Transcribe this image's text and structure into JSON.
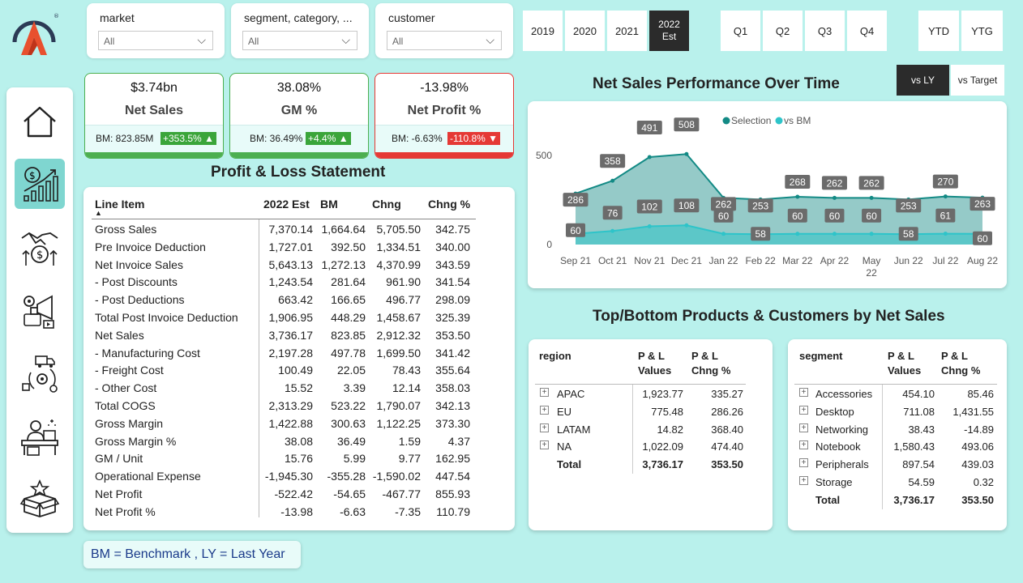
{
  "slicers": [
    {
      "label": "market",
      "value": "All"
    },
    {
      "label": "segment, category, ...",
      "value": "All"
    },
    {
      "label": "customer",
      "value": "All"
    }
  ],
  "years": [
    {
      "label": "2019",
      "selected": false
    },
    {
      "label": "2020",
      "selected": false
    },
    {
      "label": "2021",
      "selected": false
    },
    {
      "label": "2022",
      "sub": "Est",
      "selected": true
    }
  ],
  "quarters": [
    "Q1",
    "Q2",
    "Q3",
    "Q4"
  ],
  "ytd": [
    "YTD",
    "YTG"
  ],
  "compare": [
    {
      "label": "vs LY",
      "selected": true
    },
    {
      "label": "vs Target",
      "selected": false
    }
  ],
  "kpis": [
    {
      "value": "$3.74bn",
      "name": "Net Sales",
      "bm": "BM: 823.85M",
      "chg": "+353.5%",
      "dir": "up",
      "color": "#4caf50"
    },
    {
      "value": "38.08%",
      "name": "GM %",
      "bm": "BM: 36.49%",
      "chg": "+4.4%",
      "dir": "up",
      "color": "#4caf50"
    },
    {
      "value": "-13.98%",
      "name": "Net Profit %",
      "bm": "BM: -6.63%",
      "chg": "-110.8%",
      "dir": "down",
      "color": "#e53935"
    }
  ],
  "pl": {
    "title": "Profit & Loss Statement",
    "headers": [
      "Line Item",
      "2022 Est",
      "BM",
      "Chng",
      "Chng %"
    ],
    "rows": [
      [
        "Gross Sales",
        "7,370.14",
        "1,664.64",
        "5,705.50",
        "342.75"
      ],
      [
        "Pre Invoice Deduction",
        "1,727.01",
        "392.50",
        "1,334.51",
        "340.00"
      ],
      [
        "Net Invoice Sales",
        "5,643.13",
        "1,272.13",
        "4,370.99",
        "343.59"
      ],
      [
        " - Post Discounts",
        "1,243.54",
        "281.64",
        "961.90",
        "341.54"
      ],
      [
        " - Post Deductions",
        "663.42",
        "166.65",
        "496.77",
        "298.09"
      ],
      [
        "Total Post Invoice Deduction",
        "1,906.95",
        "448.29",
        "1,458.67",
        "325.39"
      ],
      [
        "Net Sales",
        "3,736.17",
        "823.85",
        "2,912.32",
        "353.50"
      ],
      [
        " - Manufacturing Cost",
        "2,197.28",
        "497.78",
        "1,699.50",
        "341.42"
      ],
      [
        " - Freight Cost",
        "100.49",
        "22.05",
        "78.43",
        "355.64"
      ],
      [
        " - Other Cost",
        "15.52",
        "3.39",
        "12.14",
        "358.03"
      ],
      [
        "Total COGS",
        "2,313.29",
        "523.22",
        "1,790.07",
        "342.13"
      ],
      [
        "Gross Margin",
        "1,422.88",
        "300.63",
        "1,122.25",
        "373.30"
      ],
      [
        "Gross Margin %",
        "38.08",
        "36.49",
        "1.59",
        "4.37"
      ],
      [
        "GM / Unit",
        "15.76",
        "5.99",
        "9.77",
        "162.95"
      ],
      [
        "Operational Expense",
        "-1,945.30",
        "-355.28",
        "-1,590.02",
        "447.54"
      ],
      [
        "Net Profit",
        "-522.42",
        "-54.65",
        "-467.77",
        "855.93"
      ],
      [
        "Net Profit %",
        "-13.98",
        "-6.63",
        "-7.35",
        "110.79"
      ]
    ]
  },
  "chart_data": {
    "type": "area",
    "title": "Net Sales Performance Over Time",
    "categories": [
      "Sep 21",
      "Oct 21",
      "Nov 21",
      "Dec 21",
      "Jan 22",
      "Feb 22",
      "Mar 22",
      "Apr 22",
      "May 22",
      "Jun 22",
      "Jul 22",
      "Aug 22"
    ],
    "series": [
      {
        "name": "Selection",
        "color": "#138a85",
        "values": [
          286,
          358,
          491,
          508,
          262,
          253,
          268,
          262,
          262,
          253,
          270,
          263
        ]
      },
      {
        "name": "vs BM",
        "color": "#2ec4c9",
        "values": [
          60,
          76,
          102,
          108,
          60,
          58,
          60,
          60,
          60,
          58,
          61,
          60
        ]
      }
    ],
    "yticks": [
      0,
      500
    ],
    "ylim": [
      0,
      560
    ],
    "legend": "top-center"
  },
  "top_bottom_title": "Top/Bottom Products & Customers by Net Sales",
  "region_table": {
    "headers": [
      "region",
      "P & L",
      "Values",
      "P & L",
      "Chng %"
    ],
    "rows": [
      [
        "APAC",
        "1,923.77",
        "335.27"
      ],
      [
        "EU",
        "775.48",
        "286.26"
      ],
      [
        "LATAM",
        "14.82",
        "368.40"
      ],
      [
        "NA",
        "1,022.09",
        "474.40"
      ]
    ],
    "total": [
      "Total",
      "3,736.17",
      "353.50"
    ]
  },
  "segment_table": {
    "headers": [
      "segment",
      "P & L",
      "Values",
      "P & L",
      "Chng %"
    ],
    "rows": [
      [
        "Accessories",
        "454.10",
        "85.46"
      ],
      [
        "Desktop",
        "711.08",
        "1,431.55"
      ],
      [
        "Networking",
        "38.43",
        "-14.89"
      ],
      [
        "Notebook",
        "1,580.43",
        "493.06"
      ],
      [
        "Peripherals",
        "897.54",
        "439.03"
      ],
      [
        "Storage",
        "54.59",
        "0.32"
      ]
    ],
    "total": [
      "Total",
      "3,736.17",
      "353.50"
    ]
  },
  "note": "BM = Benchmark , LY = Last Year",
  "nav_icons": [
    "home-icon",
    "sales-growth-icon",
    "finance-deal-icon",
    "marketing-icon",
    "supply-chain-icon",
    "executive-icon",
    "product-box-icon"
  ]
}
